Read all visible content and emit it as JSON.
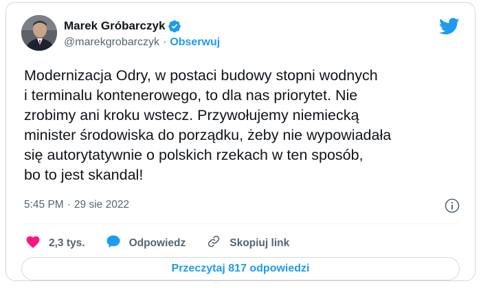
{
  "tweet": {
    "author_name": "Marek Gróbarczyk",
    "handle": "@marekgrobarczyk",
    "separator": "·",
    "follow_label": "Obserwuj",
    "text": "Modernizacja Odry, w postaci budowy stopni wodnych\ni terminalu kontenerowego, to dla nas priorytet. Nie\nzrobimy ani kroku wstecz. Przywołujemy niemiecką\nminister środowiska do porządku, żeby nie wypowiadała\nsię autorytatywnie o polskich rzekach w ten sposób,\nbo to jest skandal!",
    "time": "5:45 PM",
    "date": "29 sie 2022",
    "likes": "2,3 tys.",
    "reply_label": "Odpowiedz",
    "copy_link_label": "Skopiuj link",
    "read_replies_label": "Przeczytaj 817 odpowiedzi"
  },
  "icons": {
    "verified": "verified-badge-icon",
    "bird": "twitter-bird-icon",
    "info": "info-icon",
    "heart": "heart-icon",
    "reply": "speech-bubble-icon",
    "link": "link-icon"
  },
  "colors": {
    "accent": "#1d9bf0",
    "heart": "#f91880",
    "text": "#0f1419",
    "secondary": "#536471"
  }
}
